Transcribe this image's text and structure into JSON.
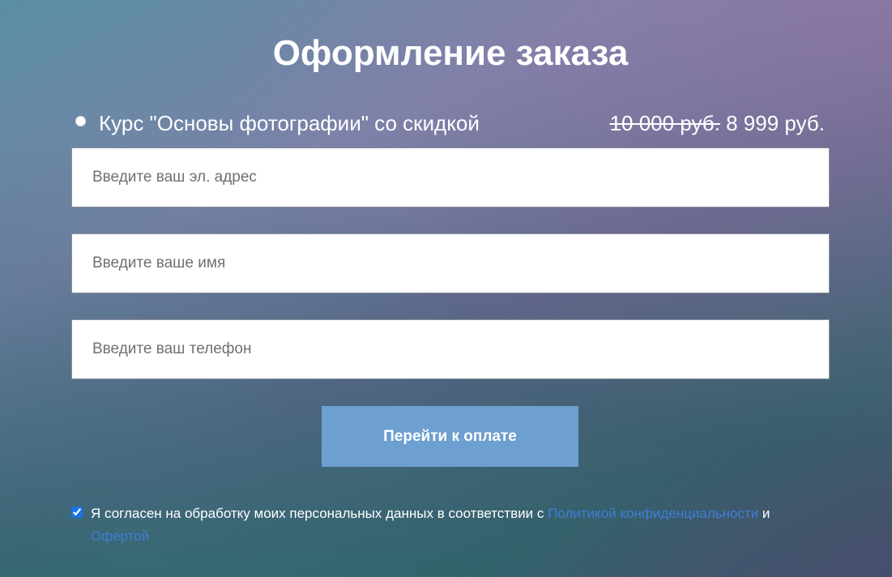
{
  "title": "Оформление заказа",
  "product": {
    "name": "Курс \"Основы фотографии\" со скидкой",
    "old_price": "10 000 руб.",
    "new_price": "8 999 руб."
  },
  "form": {
    "email_placeholder": "Введите ваш эл. адрес",
    "name_placeholder": "Введите ваше имя",
    "phone_placeholder": "Введите ваш телефон",
    "submit_label": "Перейти к оплате"
  },
  "consent": {
    "checked": true,
    "text_before": "Я согласен на обработку моих персональных данных в соответствии с",
    "privacy_link": "Политикой конфиденциальности",
    "conjunction": "и",
    "offer_link": "Офертой"
  },
  "colors": {
    "button": "#6d9fd0",
    "link": "#3f7ed6"
  }
}
